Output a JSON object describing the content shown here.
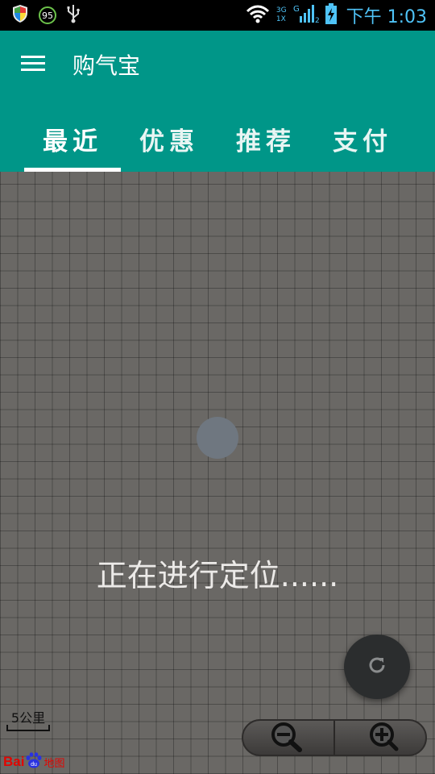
{
  "status_bar": {
    "battery_level": "95",
    "network_top": "3G",
    "network_bottom": "1X",
    "sim2_label": "2",
    "g_label": "G",
    "time": "下午 1:03"
  },
  "app_bar": {
    "title": "购气宝",
    "tabs": [
      {
        "label": "最近",
        "selected": true
      },
      {
        "label": "优惠",
        "selected": false
      },
      {
        "label": "推荐",
        "selected": false
      },
      {
        "label": "支付",
        "selected": false
      }
    ]
  },
  "map": {
    "loading_text": "正在进行定位......",
    "scale_label": "5公里",
    "logo_text": {
      "bai": "Bai",
      "du": "du",
      "map": "地图"
    }
  },
  "colors": {
    "primary": "#009688",
    "map_bg": "#6a6865",
    "fab_bg": "#2b2d2e",
    "clock": "#4fc3f7"
  },
  "icons": [
    "shield-icon",
    "usb-icon",
    "wifi-icon",
    "signal-icon",
    "battery-charging-icon",
    "menu-icon",
    "refresh-icon",
    "zoom-out-icon",
    "zoom-in-icon"
  ]
}
